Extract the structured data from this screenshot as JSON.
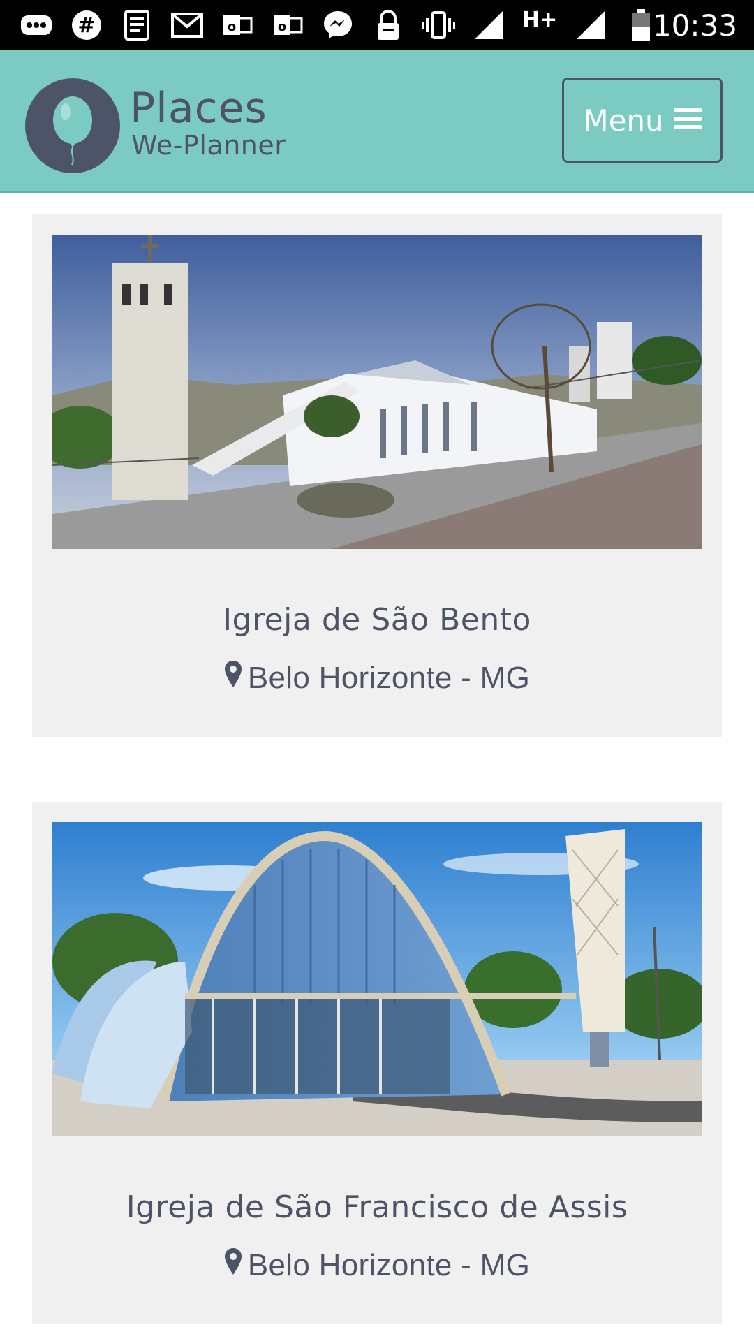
{
  "status_bar": {
    "time": "10:33",
    "network": "H+",
    "icons": [
      "more-icon",
      "hashtag-icon",
      "news-icon",
      "gmail-icon",
      "outlook-icon",
      "outlook-icon",
      "messenger-icon",
      "lock-icon",
      "vibrate-icon",
      "signal-icon",
      "battery-icon"
    ]
  },
  "header": {
    "brand_title": "Places",
    "brand_subtitle": "We-Planner",
    "menu_label": "Menu",
    "menu_icon": "hamburger-icon",
    "colors": {
      "header_bg": "#7ccbc3",
      "text": "#4e5468",
      "balloon": "#7ccbc3"
    }
  },
  "places": [
    {
      "name": "Igreja de São Bento",
      "location": "Belo Horizonte - MG",
      "location_icon": "map-marker-icon"
    },
    {
      "name": "Igreja de São Francisco de Assis",
      "location": "Belo Horizonte - MG",
      "location_icon": "map-marker-icon"
    }
  ]
}
